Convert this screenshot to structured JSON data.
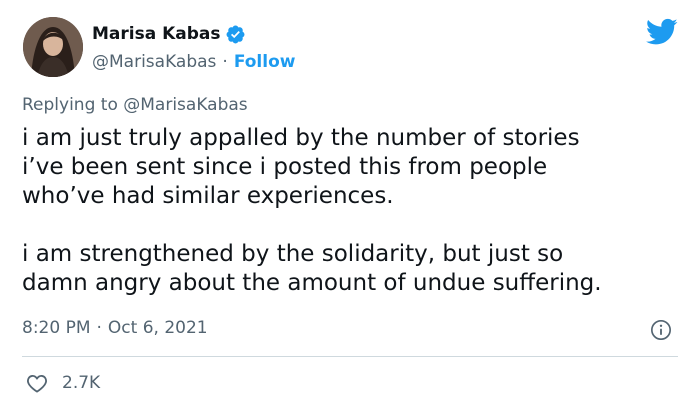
{
  "author": {
    "name": "Marisa Kabas",
    "handle": "@MarisaKabas",
    "separator": "·",
    "follow_label": "Follow"
  },
  "reply": {
    "prefix": "Replying to",
    "mention": "@MarisaKabas"
  },
  "tweet": {
    "text": "i am just truly appalled by the number of stories\ni’ve been sent since i posted this from people\nwho’ve had similar experiences.\n\ni am strengthened by the solidarity, but just so\ndamn angry about the amount of undue suffering."
  },
  "meta": {
    "time": "8:20 PM",
    "separator": "·",
    "date": "Oct 6, 2021"
  },
  "engagement": {
    "likes": "2.7K"
  },
  "colors": {
    "accent": "#1d9bf0",
    "text": "#0f1419",
    "secondary": "#536471",
    "divider": "#cfd9de"
  },
  "icons": {
    "brand": "twitter-bird-icon",
    "verified": "verified-badge-icon",
    "info": "info-icon",
    "like": "heart-icon"
  }
}
